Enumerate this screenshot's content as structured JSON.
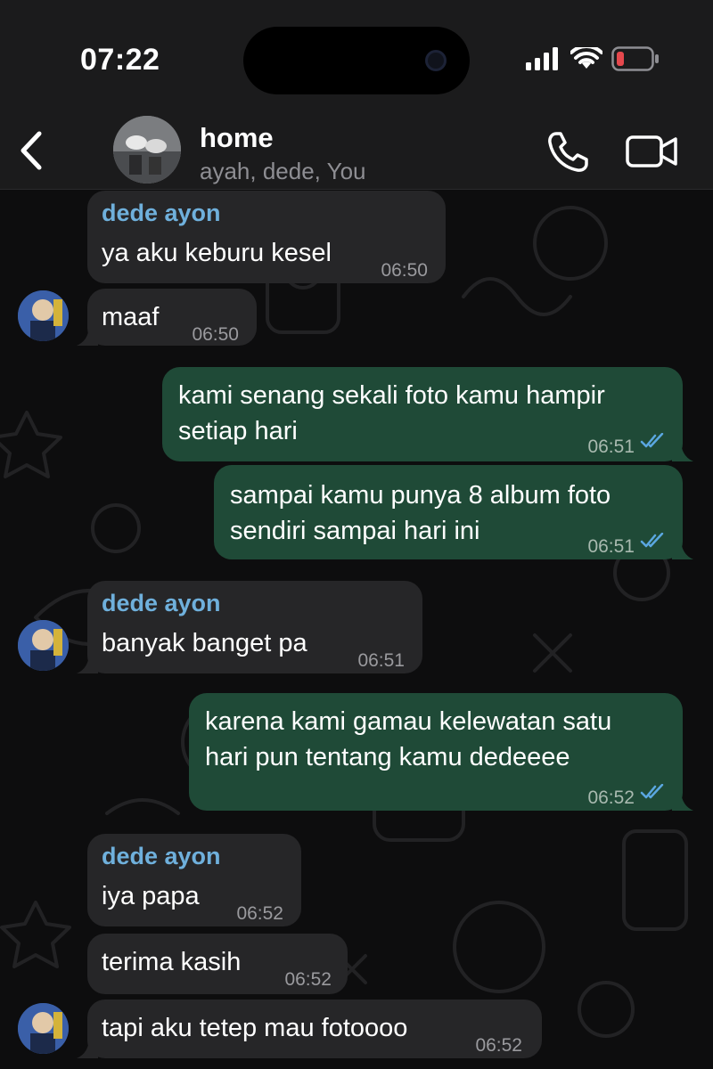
{
  "status_bar": {
    "time": "07:22",
    "icons": [
      "signal-icon",
      "wifi-icon",
      "battery-icon"
    ],
    "battery_color": "#e5484d"
  },
  "header": {
    "title": "home",
    "members": "ayah, dede, You",
    "icons": [
      "back-chevron-icon",
      "phone-icon",
      "video-camera-icon"
    ]
  },
  "colors": {
    "incoming_bubble": "#262628",
    "outgoing_bubble": "#1f4a37",
    "sender_name": "#6fb0dc",
    "read_ticks": "#5aa7e0"
  },
  "messages": [
    {
      "direction": "in",
      "sender": "dede ayon",
      "text": "ya aku keburu kesel",
      "time": "06:50"
    },
    {
      "direction": "in",
      "text": "maaf",
      "time": "06:50"
    },
    {
      "direction": "out",
      "text": "kami senang sekali foto kamu hampir",
      "text2": "setiap hari",
      "time": "06:51",
      "status": "read"
    },
    {
      "direction": "out",
      "text": "sampai kamu punya 8 album foto",
      "text2": "sendiri sampai hari ini",
      "time": "06:51",
      "status": "read"
    },
    {
      "direction": "in",
      "sender": "dede ayon",
      "text": "banyak banget pa",
      "time": "06:51"
    },
    {
      "direction": "out",
      "text": "karena kami gamau kelewatan satu",
      "text2": "hari pun tentang kamu dedeeee",
      "time": "06:52",
      "status": "read"
    },
    {
      "direction": "in",
      "sender": "dede ayon",
      "text": "iya papa",
      "time": "06:52"
    },
    {
      "direction": "in",
      "text": "terima kasih",
      "time": "06:52"
    },
    {
      "direction": "in",
      "text": "tapi aku tetep mau fotoooo",
      "time": "06:52"
    }
  ]
}
